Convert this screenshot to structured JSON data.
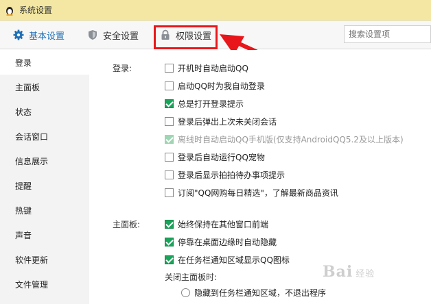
{
  "window": {
    "title": "系统设置",
    "icon": "qq-penguin-icon"
  },
  "tabs": {
    "basic": {
      "label": "基本设置",
      "icon": "gear-icon"
    },
    "security": {
      "label": "安全设置",
      "icon": "shield-icon"
    },
    "permission": {
      "label": "权限设置",
      "icon": "lock-icon"
    }
  },
  "search": {
    "placeholder": "搜索设置项"
  },
  "sidebar": {
    "items": [
      "登录",
      "主面板",
      "状态",
      "会话窗口",
      "信息展示",
      "提醒",
      "热键",
      "声音",
      "软件更新",
      "文件管理"
    ],
    "active": "登录"
  },
  "login_section": {
    "label": "登录:",
    "options": [
      {
        "label": "开机时自动启动QQ",
        "checked": false
      },
      {
        "label": "启动QQ时为我自动登录",
        "checked": false
      },
      {
        "label": "总是打开登录提示",
        "checked": true
      },
      {
        "label": "登录后弹出上次未关闭会话",
        "checked": false
      },
      {
        "label": "离线时自动启动QQ手机版(仅支持AndroidQQ5.2及以上版本)",
        "checked": true,
        "disabled": true
      },
      {
        "label": "登录后自动运行QQ宠物",
        "checked": false
      },
      {
        "label": "登录后显示拍拍待办事项提示",
        "checked": false
      },
      {
        "label": "订阅\"QQ网购每日精选\"，了解最新商品资讯",
        "checked": false
      }
    ]
  },
  "panel_section": {
    "label": "主面板:",
    "options": [
      {
        "label": "始终保持在其他窗口前端",
        "checked": true
      },
      {
        "label": "停靠在桌面边缘时自动隐藏",
        "checked": true
      },
      {
        "label": "在任务栏通知区域显示QQ图标",
        "checked": true
      }
    ],
    "close_label": "关闭主面板时:",
    "close_option": "隐藏到任务栏通知区域，不退出程序"
  },
  "watermark": {
    "text": "Bai",
    "sub": "经验"
  },
  "colors": {
    "accent": "#1f6fb5",
    "highlight": "#e8161a",
    "check": "#1aa35a",
    "titlebar": "#f3e7a3"
  }
}
